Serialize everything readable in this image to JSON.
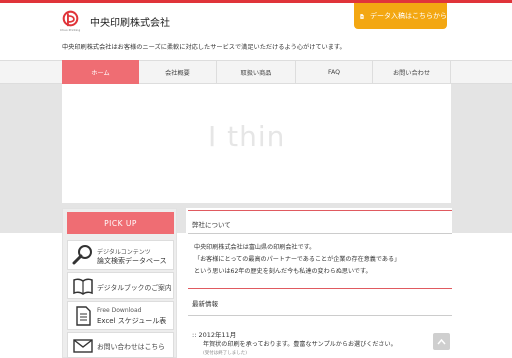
{
  "header": {
    "company": "中央印刷株式会社",
    "logo_sub": "Chuo Printing",
    "tagline": "中央印刷株式会社はお客様のニーズに柔軟に対応したサービスで満足いただけるよう心がけています。",
    "upload_label": "データ入稿はこちらから"
  },
  "nav": {
    "items": [
      "ホーム",
      "会社概要",
      "取扱い商品",
      "FAQ",
      "お問い合わせ"
    ],
    "active": 0
  },
  "hero": {
    "text": "I thin"
  },
  "sidebar": {
    "pickup": "PICK UP",
    "items": [
      {
        "line1": "デジタルコンテンツ",
        "line2": "論文検索データベース",
        "icon": "magnifier-icon"
      },
      {
        "line1": "",
        "line2": "デジタルブックのご案内",
        "icon": "open-book-icon"
      },
      {
        "line1": "Free Download",
        "line2": "Excel スケジュール表",
        "icon": "document-icon"
      },
      {
        "line1": "",
        "line2": "お問い合わせはこちら",
        "icon": "envelope-icon"
      }
    ]
  },
  "about": {
    "title": "弊社について",
    "lines": [
      "中央印刷株式会社は富山県の印刷会社です。",
      "「お客様にとっての最高のパートナーであることが企業の存在意義である」",
      "という思いは62年の歴史を刻んだ今も私達の変わらぬ思いです。"
    ]
  },
  "news": {
    "title": "最新情報",
    "date": ":: 2012年11月",
    "text": "年賀状の印刷を承っております。豊富なサンプルからお選びください。",
    "note": "(受付は終了しました)"
  },
  "colors": {
    "accent": "#ef6d73",
    "brand_red": "#e0343a",
    "upload_orange": "#f3a712"
  }
}
